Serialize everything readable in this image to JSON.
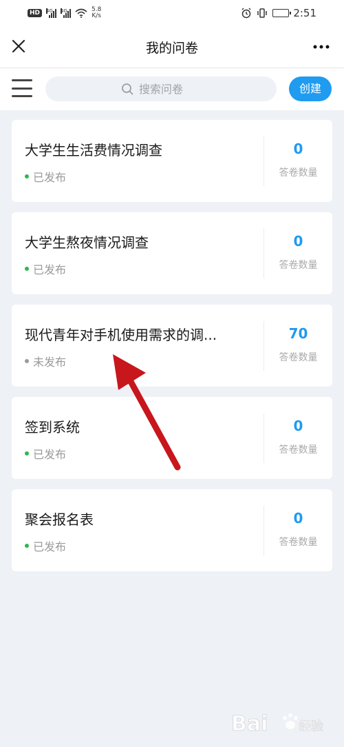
{
  "status_bar": {
    "hd": "HD",
    "net1": "4G",
    "net2": "4G",
    "speed_value": "5.8",
    "speed_unit": "K/s",
    "time": "2:51"
  },
  "header": {
    "title": "我的问卷"
  },
  "toolbar": {
    "search_placeholder": "搜索问卷",
    "create_label": "创建"
  },
  "surveys": [
    {
      "title": "大学生生活费情况调查",
      "status": "已发布",
      "published": true,
      "count": "0",
      "count_label": "答卷数量"
    },
    {
      "title": "大学生熬夜情况调查",
      "status": "已发布",
      "published": true,
      "count": "0",
      "count_label": "答卷数量"
    },
    {
      "title": "现代青年对手机使用需求的调...",
      "status": "未发布",
      "published": false,
      "count": "70",
      "count_label": "答卷数量"
    },
    {
      "title": "签到系统",
      "status": "已发布",
      "published": true,
      "count": "0",
      "count_label": "答卷数量"
    },
    {
      "title": "聚会报名表",
      "status": "已发布",
      "published": true,
      "count": "0",
      "count_label": "答卷数量"
    }
  ],
  "colors": {
    "accent": "#1f9bf0",
    "published_dot": "#2db84c",
    "unpublished_dot": "#9a9a9a",
    "annotation_arrow": "#c8161d",
    "background": "#eef1f6"
  },
  "icons": {
    "close": "close-icon",
    "more": "more-icon",
    "menu": "menu-icon",
    "search": "search-icon"
  }
}
